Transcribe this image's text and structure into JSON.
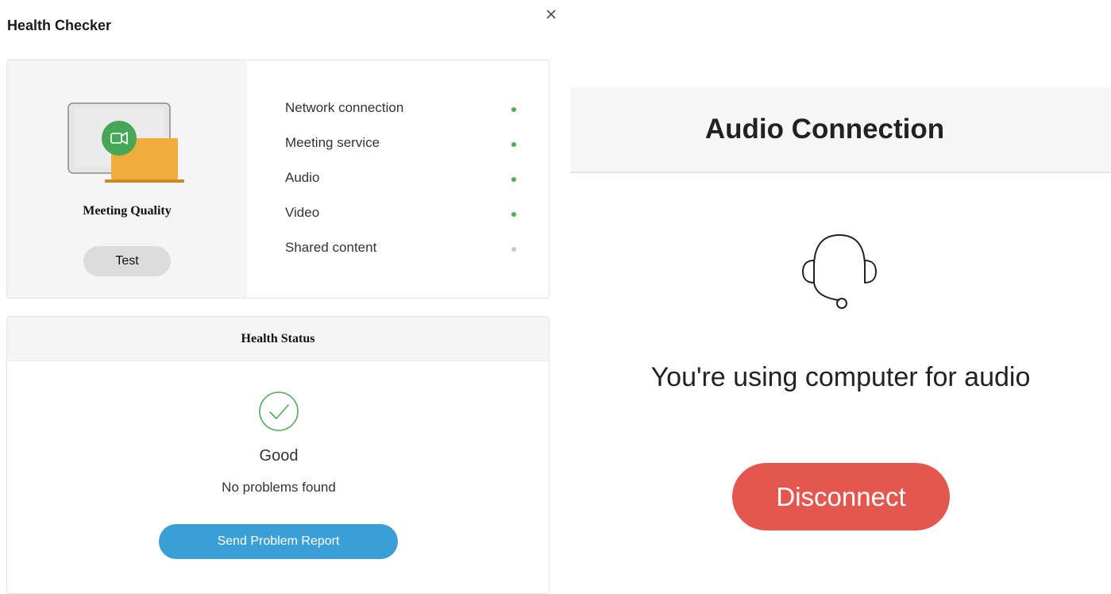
{
  "health_checker": {
    "title": "Health Checker",
    "close_glyph": "×",
    "meeting_quality": {
      "label": "Meeting Quality",
      "test_button": "Test",
      "illustration_icon": "video-camera-icon",
      "checks": [
        {
          "label": "Network connection",
          "status": "ok",
          "color": "#4caf50"
        },
        {
          "label": "Meeting service",
          "status": "ok",
          "color": "#4caf50"
        },
        {
          "label": "Audio",
          "status": "ok",
          "color": "#4caf50"
        },
        {
          "label": "Video",
          "status": "ok",
          "color": "#4caf50"
        },
        {
          "label": "Shared content",
          "status": "inactive",
          "color": "#c8c8c8"
        }
      ]
    },
    "health_status": {
      "header": "Health Status",
      "status_icon": "check-circle-icon",
      "status": "Good",
      "message": "No problems found",
      "report_button": "Send Problem Report"
    }
  },
  "audio_connection": {
    "title": "Audio Connection",
    "icon": "headset-icon",
    "message": "You're using computer for audio",
    "disconnect_button": "Disconnect"
  },
  "colors": {
    "accent_blue": "#3a9fd6",
    "danger_red": "#e4574e",
    "ok_green": "#4caf50",
    "device_orange": "#f0ad3c"
  }
}
